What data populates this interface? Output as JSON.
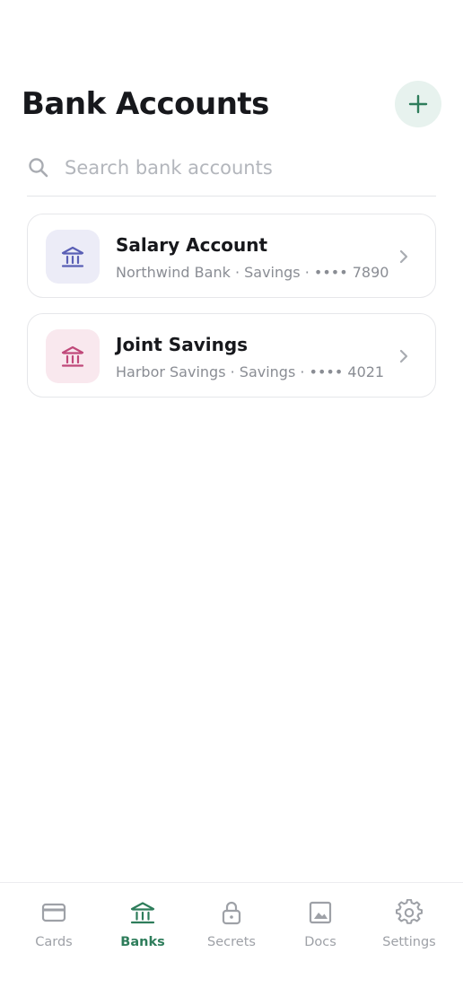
{
  "header": {
    "title": "Bank Accounts",
    "add_icon": "plus-icon",
    "accent_color": "#2e7d5b"
  },
  "search": {
    "placeholder": "Search bank accounts",
    "value": "",
    "icon": "search-icon"
  },
  "accounts": [
    {
      "name": "Salary Account",
      "details": "Northwind Bank · Savings · •••• 7890",
      "icon": "bank-icon",
      "icon_color": "#5a5fb5",
      "icon_bg": "#ececf7"
    },
    {
      "name": "Joint Savings",
      "details": "Harbor Savings · Savings · •••• 4021",
      "icon": "bank-icon",
      "icon_color": "#c0497a",
      "icon_bg": "#f9e8ee"
    }
  ],
  "bottom_nav": {
    "active": "Banks",
    "items": [
      {
        "label": "Cards",
        "icon": "credit-card-icon"
      },
      {
        "label": "Banks",
        "icon": "bank-icon"
      },
      {
        "label": "Secrets",
        "icon": "lock-icon"
      },
      {
        "label": "Docs",
        "icon": "image-icon"
      },
      {
        "label": "Settings",
        "icon": "gear-icon"
      }
    ]
  }
}
